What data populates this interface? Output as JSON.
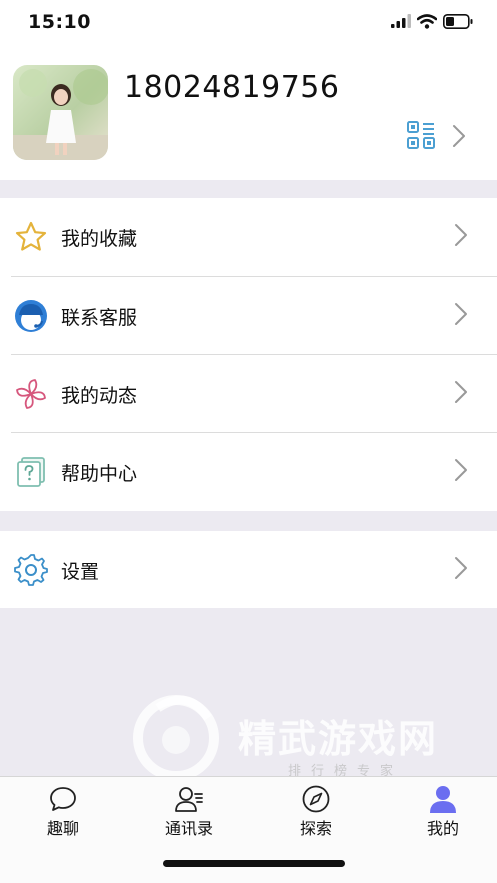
{
  "status_bar": {
    "time": "15:10"
  },
  "profile": {
    "phone": "18024819756"
  },
  "menu": {
    "items": [
      {
        "label": "我的收藏",
        "icon": "star-icon",
        "color": "#e4b33b"
      },
      {
        "label": "联系客服",
        "icon": "customer-service-icon",
        "color": "#2f7fd6"
      },
      {
        "label": "我的动态",
        "icon": "pinwheel-icon",
        "color": "#d6577d"
      },
      {
        "label": "帮助中心",
        "icon": "help-doc-icon",
        "color": "#7fbfb0"
      }
    ],
    "settings": {
      "label": "设置",
      "icon": "gear-icon",
      "color": "#3b8fc9"
    }
  },
  "tabs": [
    {
      "label": "趣聊",
      "icon": "chat-bubble-icon",
      "active": false
    },
    {
      "label": "通讯录",
      "icon": "contacts-icon",
      "active": false
    },
    {
      "label": "探索",
      "icon": "compass-icon",
      "active": false
    },
    {
      "label": "我的",
      "icon": "profile-icon",
      "active": true,
      "color": "#6b6ef0"
    }
  ],
  "watermark": {
    "title": "精武游戏网",
    "subtitle": "排行榜专家"
  }
}
